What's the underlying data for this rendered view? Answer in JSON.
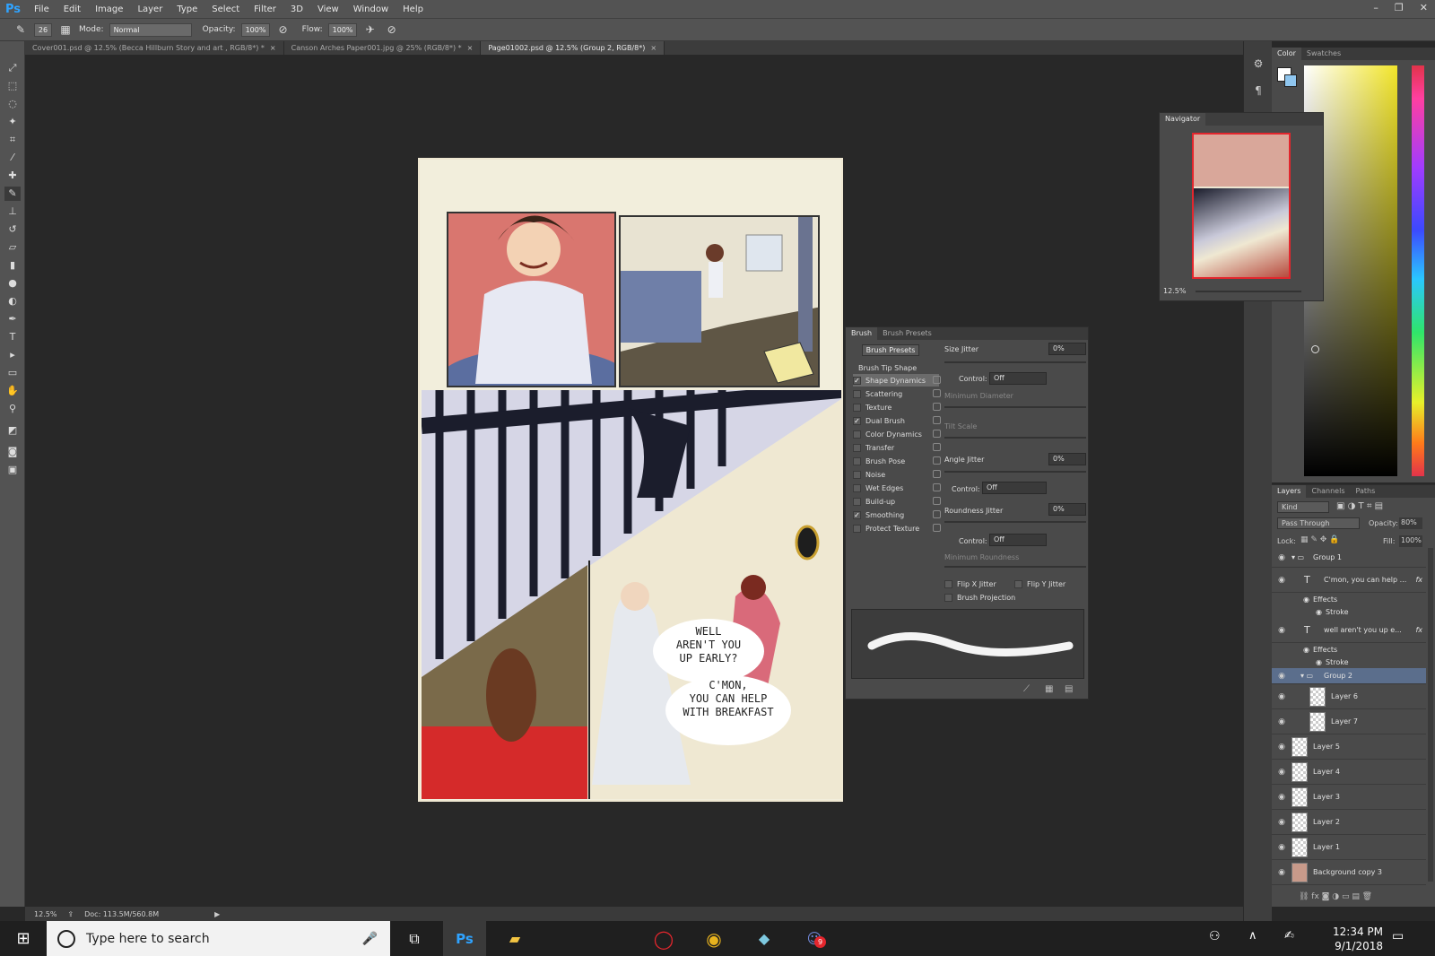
{
  "app": {
    "logo": "Ps",
    "menu": [
      "File",
      "Edit",
      "Image",
      "Layer",
      "Type",
      "Select",
      "Filter",
      "3D",
      "View",
      "Window",
      "Help"
    ]
  },
  "options": {
    "brush_size": "26",
    "mode_label": "Mode:",
    "mode_value": "Normal",
    "opacity_label": "Opacity:",
    "opacity_value": "100%",
    "flow_label": "Flow:",
    "flow_value": "100%"
  },
  "tabs": [
    {
      "label": "Cover001.psd @ 12.5% (Becca Hillburn Story and art , RGB/8*) *",
      "active": false
    },
    {
      "label": "Canson Arches Paper001.jpg @ 25% (RGB/8*) *",
      "active": false
    },
    {
      "label": "Page01002.psd @ 12.5% (Group 2, RGB/8*)",
      "active": true
    }
  ],
  "canvas": {
    "speech1": "WELL\nAREN'T YOU\nUP EARLY?",
    "speech2": "C'MON,\nYOU CAN HELP\nWITH BREAKFAST"
  },
  "status": {
    "zoom": "12.5%",
    "doc": "Doc: 113.5M/560.8M"
  },
  "color_panel": {
    "tabs": [
      "Color",
      "Swatches"
    ]
  },
  "navigator": {
    "title": "Navigator",
    "zoom": "12.5%"
  },
  "brush_panel": {
    "tabs": [
      "Brush",
      "Brush Presets"
    ],
    "presets_button": "Brush Presets",
    "tip_shape": "Brush Tip Shape",
    "options": [
      {
        "label": "Shape Dynamics",
        "checked": true
      },
      {
        "label": "Scattering",
        "checked": false
      },
      {
        "label": "Texture",
        "checked": false
      },
      {
        "label": "Dual Brush",
        "checked": true
      },
      {
        "label": "Color Dynamics",
        "checked": false
      },
      {
        "label": "Transfer",
        "checked": false
      },
      {
        "label": "Brush Pose",
        "checked": false
      },
      {
        "label": "Noise",
        "checked": false
      },
      {
        "label": "Wet Edges",
        "checked": false
      },
      {
        "label": "Build-up",
        "checked": false
      },
      {
        "label": "Smoothing",
        "checked": true
      },
      {
        "label": "Protect Texture",
        "checked": false
      }
    ],
    "size_jitter_label": "Size Jitter",
    "size_jitter_value": "0%",
    "control_label": "Control:",
    "control_value": "Off",
    "min_diameter": "Minimum Diameter",
    "tilt_scale": "Tilt Scale",
    "angle_jitter_label": "Angle Jitter",
    "angle_jitter_value": "0%",
    "roundness_jitter_label": "Roundness Jitter",
    "roundness_jitter_value": "0%",
    "min_roundness": "Minimum Roundness",
    "flip_x": "Flip X Jitter",
    "flip_y": "Flip Y Jitter",
    "brush_projection": "Brush Projection"
  },
  "layers_panel": {
    "tabs": [
      "Layers",
      "Channels",
      "Paths"
    ],
    "kind": "Kind",
    "blend": "Pass Through",
    "opacity_label": "Opacity:",
    "opacity_value": "80%",
    "lock_label": "Lock:",
    "fill_label": "Fill:",
    "fill_value": "100%",
    "layers": [
      {
        "name": "Group 1",
        "kind": "group"
      },
      {
        "name": "C'mon, you can help ...",
        "kind": "text"
      },
      {
        "name": "Effects",
        "kind": "sub"
      },
      {
        "name": "Stroke",
        "kind": "sub"
      },
      {
        "name": "well aren't you up e...",
        "kind": "text"
      },
      {
        "name": "Effects",
        "kind": "sub"
      },
      {
        "name": "Stroke",
        "kind": "sub"
      },
      {
        "name": "Group 2",
        "kind": "group"
      },
      {
        "name": "Layer 6",
        "kind": "layer"
      },
      {
        "name": "Layer 7",
        "kind": "layer"
      },
      {
        "name": "Layer 5",
        "kind": "layer"
      },
      {
        "name": "Layer 4",
        "kind": "layer"
      },
      {
        "name": "Layer 3",
        "kind": "layer"
      },
      {
        "name": "Layer 2",
        "kind": "layer"
      },
      {
        "name": "Layer 1",
        "kind": "layer"
      },
      {
        "name": "Background copy 3",
        "kind": "layer"
      }
    ]
  },
  "taskbar": {
    "search_placeholder": "Type here to search",
    "time": "12:34 PM",
    "date": "9/1/2018",
    "discord_badge": "9"
  },
  "colors": {
    "accent": "#2fa3ff",
    "selected_layer": "#5b6e8c"
  }
}
